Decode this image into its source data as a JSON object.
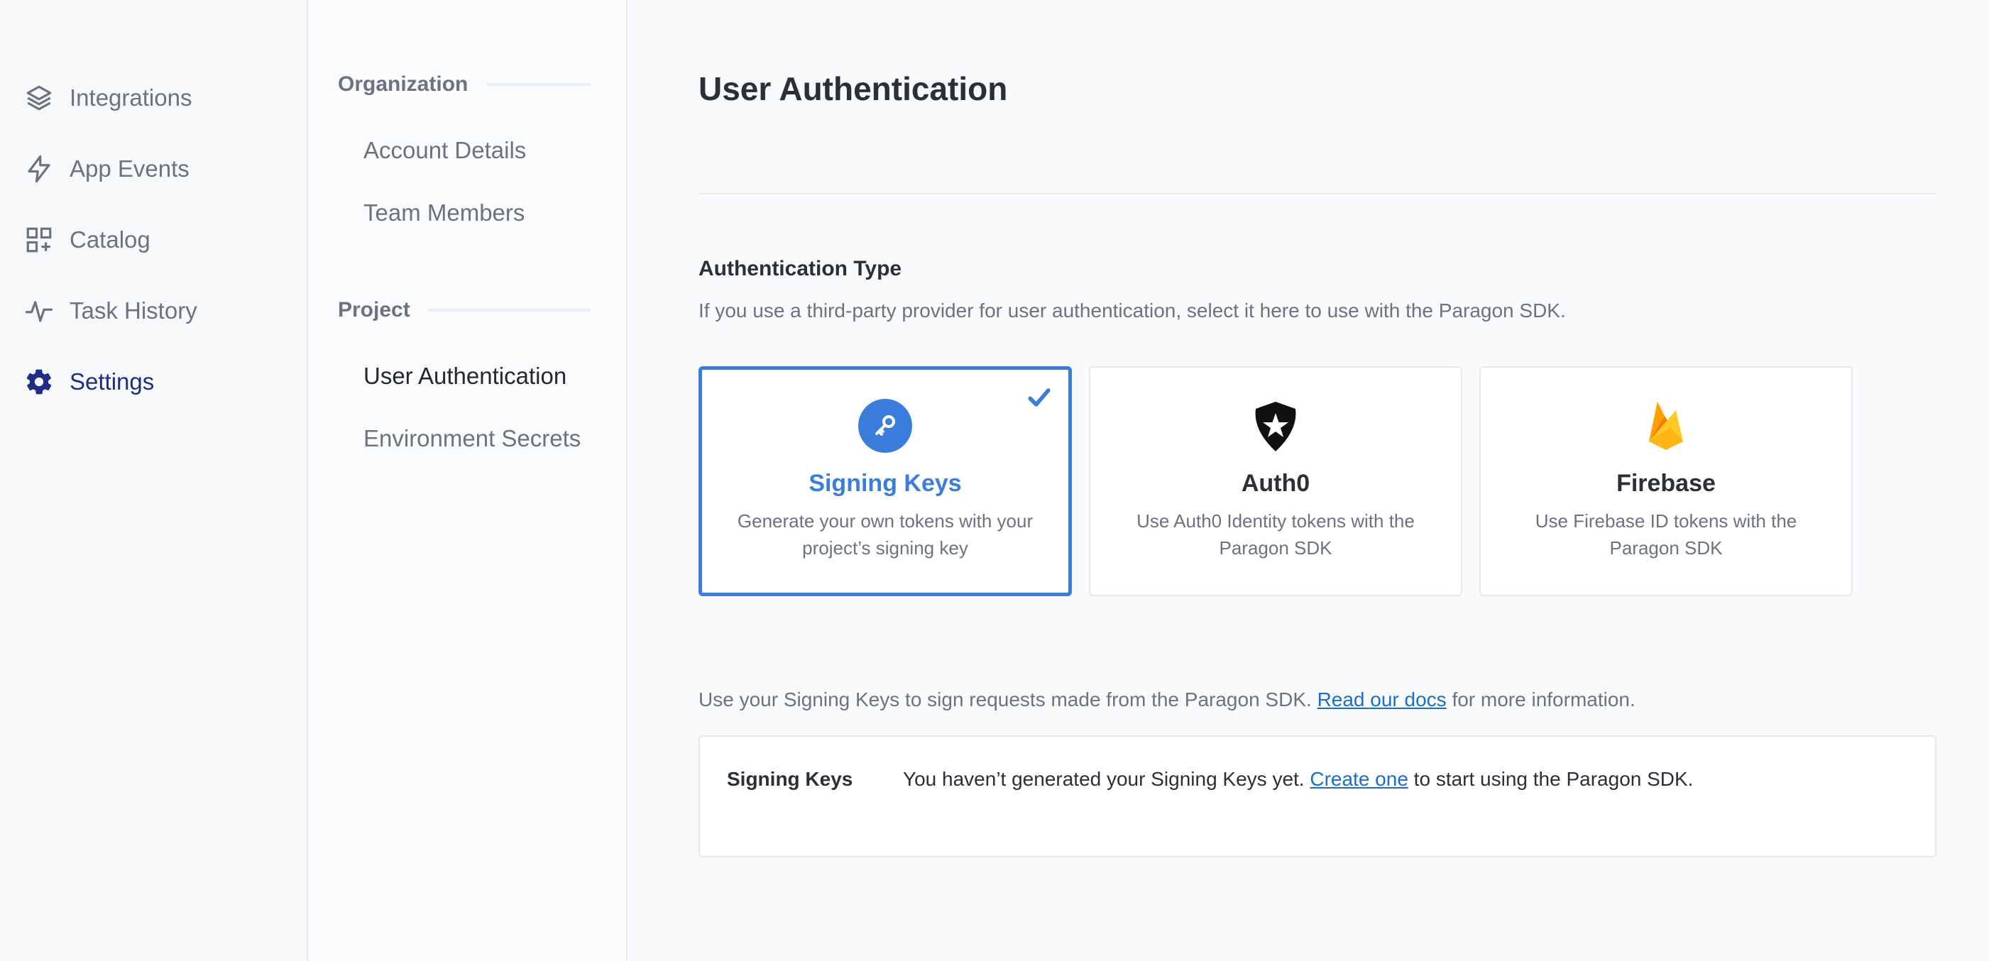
{
  "nav": {
    "items": [
      {
        "label": "Integrations",
        "icon": "layers-icon"
      },
      {
        "label": "App Events",
        "icon": "lightning-icon"
      },
      {
        "label": "Catalog",
        "icon": "grid-plus-icon"
      },
      {
        "label": "Task History",
        "icon": "activity-icon"
      },
      {
        "label": "Settings",
        "icon": "gear-icon",
        "active": true
      }
    ]
  },
  "subnav": {
    "organization": {
      "heading": "Organization",
      "items": [
        "Account Details",
        "Team Members"
      ]
    },
    "project": {
      "heading": "Project",
      "items": [
        "User Authentication",
        "Environment Secrets"
      ],
      "active": "User Authentication"
    }
  },
  "main": {
    "title": "User Authentication",
    "auth_type": {
      "heading": "Authentication Type",
      "description": "If you use a third-party provider for user authentication, select it here to use with the Paragon SDK."
    },
    "cards": [
      {
        "title": "Signing Keys",
        "desc": "Generate your own tokens with your project’s signing key",
        "icon": "key-icon",
        "selected": true
      },
      {
        "title": "Auth0",
        "desc": "Use Auth0 Identity tokens with the Paragon SDK",
        "icon": "auth0-logo-icon",
        "selected": false
      },
      {
        "title": "Firebase",
        "desc": "Use Firebase ID tokens with the Paragon SDK",
        "icon": "firebase-logo-icon",
        "selected": false
      }
    ],
    "signing_info": {
      "before": "Use your Signing Keys to sign requests made from the Paragon SDK. ",
      "link": "Read our docs",
      "after": " for more information."
    },
    "signing_box": {
      "label": "Signing Keys",
      "before": "You haven’t generated your Signing Keys yet. ",
      "link": "Create one",
      "after": " to start using the Paragon SDK."
    }
  },
  "colors": {
    "accent": "#3b7ddd",
    "active_nav": "#1f2d86",
    "link": "#1a6fc8",
    "firebase_yellow": "#ffca28",
    "firebase_orange": "#f57c00"
  }
}
